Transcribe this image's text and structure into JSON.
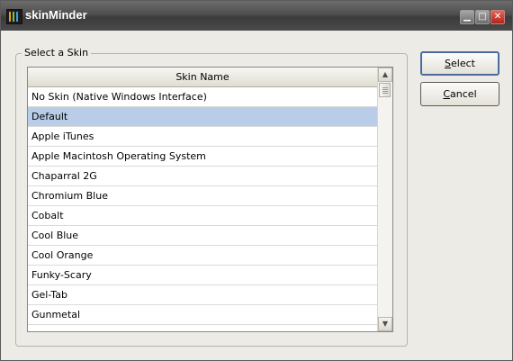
{
  "window": {
    "title": "skinMinder"
  },
  "group": {
    "label": "Select a Skin"
  },
  "list": {
    "column_header": "Skin Name",
    "selected_index": 1,
    "rows": [
      "No Skin (Native Windows Interface)",
      "Default",
      "Apple iTunes",
      "Apple Macintosh Operating System",
      "Chaparral 2G",
      "Chromium Blue",
      "Cobalt",
      "Cool Blue",
      "Cool Orange",
      "Funky-Scary",
      "Gel-Tab",
      "Gunmetal"
    ]
  },
  "buttons": {
    "select": {
      "mnemonic": "S",
      "rest": "elect"
    },
    "cancel": {
      "mnemonic": "C",
      "rest": "ancel"
    }
  },
  "colors": {
    "selection": "#b9cde9",
    "titlebar": "#4e4e4e",
    "close_button": "#c2352a"
  },
  "icons": {
    "app": "skinminder-app-icon",
    "minimize": "minimize-icon",
    "maximize": "maximize-icon",
    "close": "close-icon",
    "scroll_up": "chevron-up-icon",
    "scroll_down": "chevron-down-icon"
  }
}
